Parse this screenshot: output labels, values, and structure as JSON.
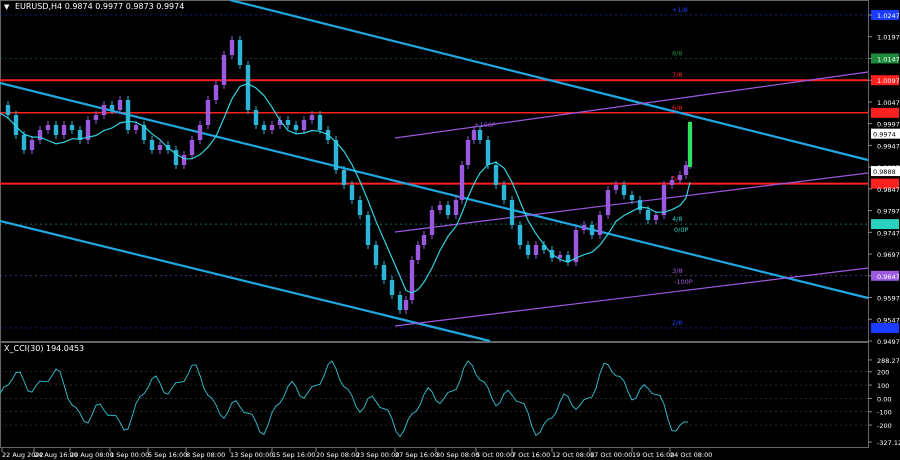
{
  "header": {
    "symbol": "EURUSD,H4",
    "ohlc": "0.9874 0.9977 0.9873 0.9974"
  },
  "indicator": {
    "label": "X_CCI(30) 194.0453"
  },
  "price_axis": {
    "ticks": [
      "1.0247",
      "1.0197",
      "1.0147",
      "1.0097",
      "1.0047",
      "0.9997",
      "0.9947",
      "0.9897",
      "0.9847",
      "0.9797",
      "0.9747",
      "0.9697",
      "0.9647",
      "0.9597",
      "0.9547",
      "0.9497"
    ],
    "current_price_label": "0.9974",
    "highlight_label": "0.9888"
  },
  "cci_axis": {
    "ticks": [
      "288.2764",
      "200",
      "100",
      "0.00",
      "-100",
      "-200",
      "-327.1286"
    ]
  },
  "time_axis": {
    "labels": [
      "22 Aug 2022",
      "24 Aug 16:00",
      "29 Aug 08:00",
      "1 Sep 00:00",
      "5 Sep 16:00",
      "8 Sep 08:00",
      "13 Sep 00:00",
      "15 Sep 16:00",
      "20 Sep 08:00",
      "23 Sep 00:00",
      "27 Sep 16:00",
      "30 Sep 08:00",
      "5 Oct 00:00",
      "7 Oct 16:00",
      "12 Oct 08:00",
      "17 Oct 00:00",
      "19 Oct 16:00",
      "24 Oct 08:00"
    ]
  },
  "level_labels": {
    "m_plus_1_8": "+1/8",
    "m_8_8": "8/8",
    "m_7_8": "7/8",
    "m_6_8": "6/8",
    "m_5_8": "5/8",
    "m_4_8": "4/8",
    "m_3_8": "3/8",
    "m_2_8": "2/8"
  },
  "channel_labels": {
    "upper": "+100P",
    "mid": "0P",
    "lower": "-100P",
    "mid2": "0/0P"
  },
  "colors": {
    "background": "#000000",
    "bull_candle": "#9b59e0",
    "bear_candle": "#2bb5d8",
    "trend_line": "#1fa7e0",
    "red_level": "#ff2020",
    "channel": "#9b59e0",
    "ma": "#33d2e0",
    "cci": "#33c4d6"
  }
}
